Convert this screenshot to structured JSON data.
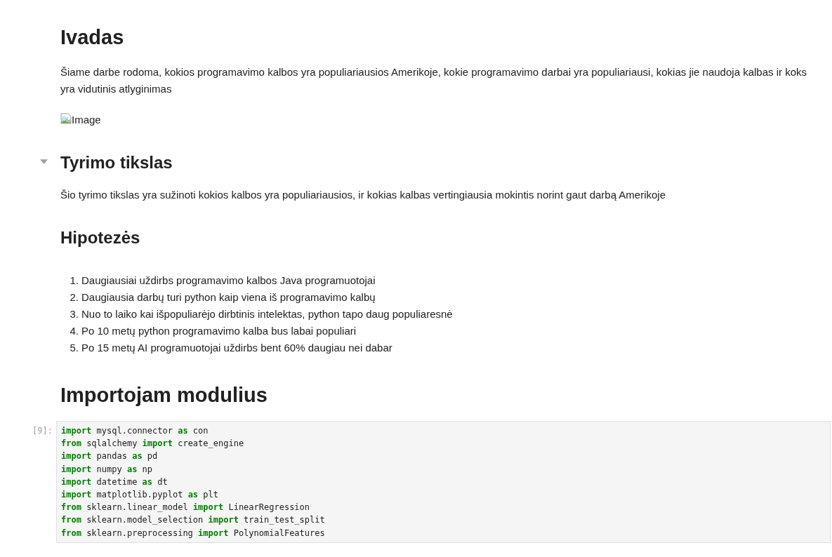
{
  "cells": [
    {
      "kind": "markdown",
      "blocks": [
        {
          "kind": "heading1",
          "text": "Ivadas"
        },
        {
          "kind": "paragraph",
          "text": "Šiame darbe rodoma, kokios programavimo kalbos yra populiariausios Amerikoje, kokie programavimo darbai yra populiariausi, kokias jie naudoja kalbas ir koks yra vidutinis atlyginimas"
        },
        {
          "kind": "image",
          "alt": "Image"
        }
      ]
    },
    {
      "kind": "markdown",
      "blocks": [
        {
          "kind": "heading2",
          "text": "Tyrimo tikslas",
          "expanded": true
        },
        {
          "kind": "paragraph",
          "text": "Šio tyrimo tikslas yra sužinoti kokios kalbos yra populiariausios, ir kokias kalbas vertingiausia mokintis norint gaut darbą Amerikoje"
        }
      ]
    },
    {
      "kind": "markdown",
      "blocks": [
        {
          "kind": "heading2",
          "text": "Hipotezės"
        },
        {
          "kind": "ordered_list",
          "items": [
            {
              "marker": "1.",
              "text": "Daugiausiai uždirbs programavimo kalbos Java programuotojai"
            },
            {
              "marker": "2.",
              "text": "Daugiausia darbų turi python kaip viena iš programavimo kalbų"
            },
            {
              "marker": "3.",
              "text": "Nuo to laiko kai išpopuliarėjo dirbtinis intelektas, python tapo daug populiaresnė"
            },
            {
              "marker": "4.",
              "text": "Po 10 metų python programavimo kalba bus labai populiari"
            },
            {
              "marker": "5.",
              "text": "Po 15 metų AI programuotojai uždirbs bent 60% daugiau nei dabar"
            }
          ]
        }
      ]
    },
    {
      "kind": "markdown",
      "blocks": [
        {
          "kind": "heading1",
          "text": "Importojam modulius"
        }
      ]
    },
    {
      "kind": "code",
      "prompt": "[9]:",
      "lines": [
        [
          {
            "kind": "keyword",
            "text": "import"
          },
          {
            "kind": "plain",
            "text": " mysql.connector "
          },
          {
            "kind": "keyword",
            "text": "as"
          },
          {
            "kind": "plain",
            "text": " con"
          }
        ],
        [
          {
            "kind": "keyword",
            "text": "from"
          },
          {
            "kind": "plain",
            "text": " sqlalchemy "
          },
          {
            "kind": "keyword",
            "text": "import"
          },
          {
            "kind": "plain",
            "text": " create_engine"
          }
        ],
        [
          {
            "kind": "keyword",
            "text": "import"
          },
          {
            "kind": "plain",
            "text": " pandas "
          },
          {
            "kind": "keyword",
            "text": "as"
          },
          {
            "kind": "plain",
            "text": " pd"
          }
        ],
        [
          {
            "kind": "keyword",
            "text": "import"
          },
          {
            "kind": "plain",
            "text": " numpy "
          },
          {
            "kind": "keyword",
            "text": "as"
          },
          {
            "kind": "plain",
            "text": " np"
          }
        ],
        [
          {
            "kind": "keyword",
            "text": "import"
          },
          {
            "kind": "plain",
            "text": " datetime "
          },
          {
            "kind": "keyword",
            "text": "as"
          },
          {
            "kind": "plain",
            "text": " dt"
          }
        ],
        [
          {
            "kind": "keyword",
            "text": "import"
          },
          {
            "kind": "plain",
            "text": " matplotlib.pyplot "
          },
          {
            "kind": "keyword",
            "text": "as"
          },
          {
            "kind": "plain",
            "text": " plt"
          }
        ],
        [
          {
            "kind": "keyword",
            "text": "from"
          },
          {
            "kind": "plain",
            "text": " sklearn.linear_model "
          },
          {
            "kind": "keyword",
            "text": "import"
          },
          {
            "kind": "plain",
            "text": " LinearRegression"
          }
        ],
        [
          {
            "kind": "keyword",
            "text": "from"
          },
          {
            "kind": "plain",
            "text": " sklearn.model_selection "
          },
          {
            "kind": "keyword",
            "text": "import"
          },
          {
            "kind": "plain",
            "text": " train_test_split"
          }
        ],
        [
          {
            "kind": "keyword",
            "text": "from"
          },
          {
            "kind": "plain",
            "text": " sklearn.preprocessing "
          },
          {
            "kind": "keyword",
            "text": "import"
          },
          {
            "kind": "plain",
            "text": " PolynomialFeatures"
          }
        ]
      ]
    }
  ]
}
